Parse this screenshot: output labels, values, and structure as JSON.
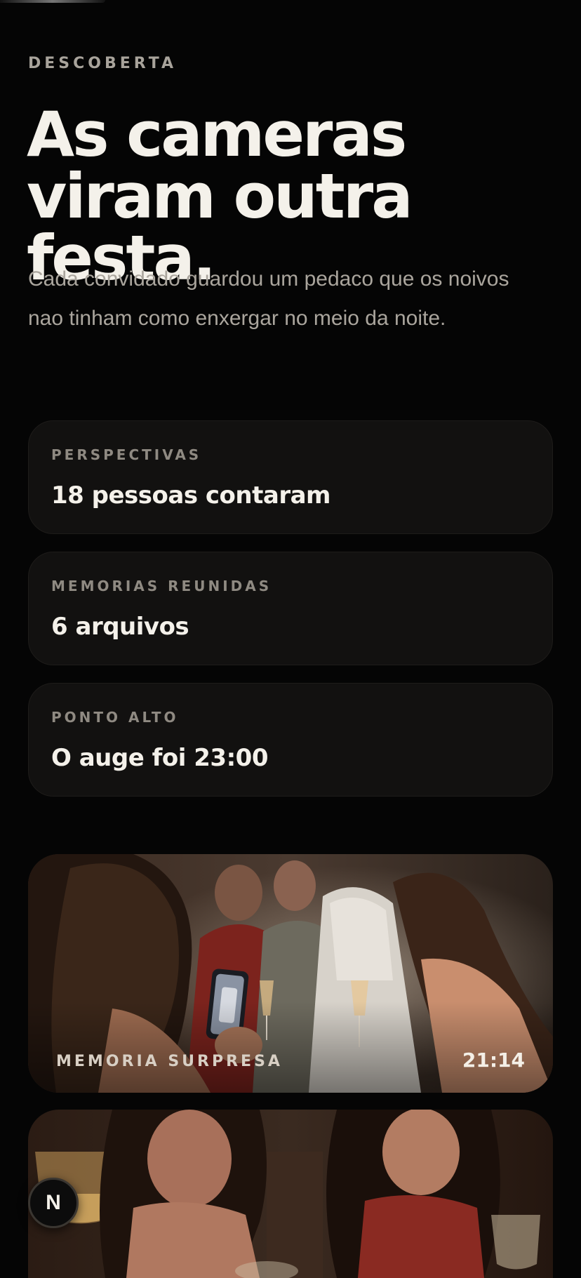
{
  "section": {
    "eyebrow": "DESCOBERTA",
    "title": "As cameras\nviram outra festa.",
    "subtitle": "Cada convidado guardou um pedaco que os noivos nao tinham como enxergar no meio da noite."
  },
  "stats": [
    {
      "label": "PERSPECTIVAS",
      "value": "18 pessoas contaram"
    },
    {
      "label": "MEMORIAS REUNIDAS",
      "value": "6 arquivos"
    },
    {
      "label": "PONTO ALTO",
      "value": "O auge foi 23:00"
    }
  ],
  "memories": [
    {
      "label": "MEMORIA SURPRESA",
      "time": "21:14"
    },
    {
      "label": "",
      "time": ""
    }
  ],
  "nav": {
    "fab_letter": "N"
  },
  "colors": {
    "background": "#050505",
    "card": "#121110",
    "text_primary": "#f4f1ea",
    "text_muted": "#a8a39b"
  }
}
